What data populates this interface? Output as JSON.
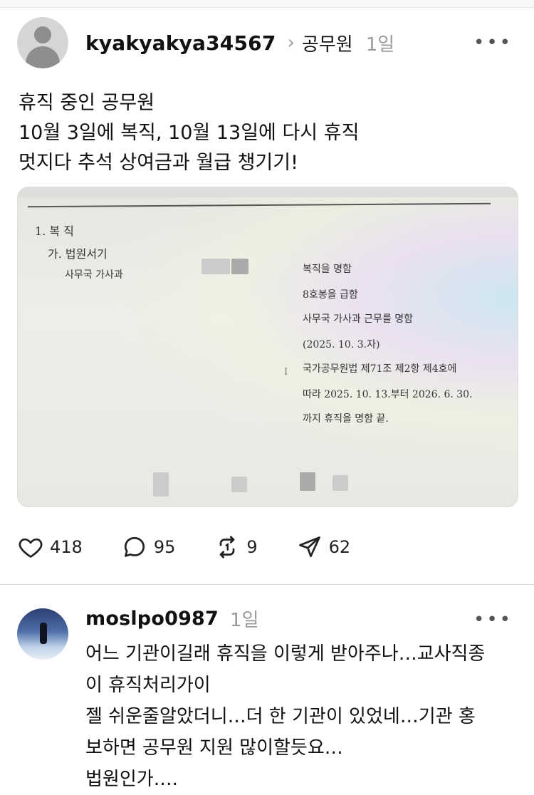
{
  "post": {
    "username": "kyakyakya34567",
    "chevron": "›",
    "topic": "공무원",
    "time": "1일",
    "more": "•••",
    "text_lines": [
      "휴직 중인 공무원",
      "10월 3일에 복직, 10월 13일에 다시 휴직",
      "멋지다 추석 상여금과 월급 챙기기!"
    ],
    "image": {
      "heading": "1. 복  직",
      "sub_heading": "가. 법원서기",
      "dept": "사무국 가사과",
      "lines": [
        "복직을 명함",
        "8호봉을 급함",
        "사무국 가사과 근무를 명함",
        "(2025. 10. 3.자)",
        "국가공무원법 제71조 제2항 제4호에",
        "따라 2025. 10. 13.부터 2026. 6. 30.",
        "까지 휴직을 명함  끝."
      ]
    },
    "actions": {
      "likes": "418",
      "comments": "95",
      "reposts": "9",
      "shares": "62",
      "like_icon": "heart-icon",
      "comment_icon": "speech-bubble-icon",
      "repost_icon": "repost-icon",
      "share_icon": "paper-plane-icon"
    }
  },
  "comment": {
    "username": "moslpo0987",
    "time": "1일",
    "more": "•••",
    "text_lines": [
      "어느 기관이길래 휴직을 이렇게 받아주나…교사직종",
      "이 휴직처리가이",
      "젤 쉬운줄알았더니…더 한 기관이 있었네…기관 홍",
      "보하면 공무원 지원 많이할듯요…",
      "법원인가…."
    ]
  }
}
